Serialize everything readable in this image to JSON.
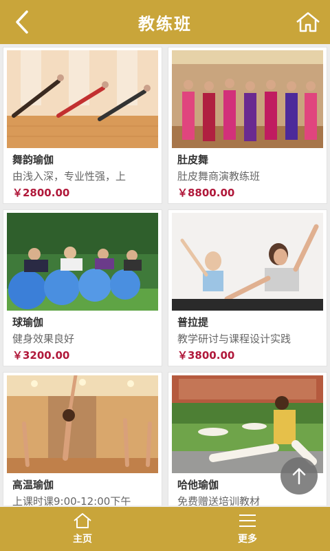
{
  "header": {
    "title": "教练班",
    "back_icon": "back-arrow-icon",
    "home_icon": "home-icon"
  },
  "courses": [
    {
      "name": "舞韵瑜伽",
      "desc": "由浅入深，专业性强，上",
      "price": "￥2800.00"
    },
    {
      "name": "肚皮舞",
      "desc": "肚皮舞商演教练班",
      "price": "￥8800.00"
    },
    {
      "name": "球瑜伽",
      "desc": "健身效果良好",
      "price": "￥3200.00"
    },
    {
      "name": "普拉提",
      "desc": "教学研讨与课程设计实践",
      "price": "￥3800.00"
    },
    {
      "name": "高温瑜伽",
      "desc": "上课时课9:00-12:00下午",
      "price": ""
    },
    {
      "name": "哈他瑜伽",
      "desc": "免费赠送培训教材",
      "price": ""
    }
  ],
  "footer": {
    "home_label": "主页",
    "more_label": "更多"
  },
  "colors": {
    "brand": "#c9a53a",
    "price": "#b0183a",
    "background": "#ececec"
  }
}
